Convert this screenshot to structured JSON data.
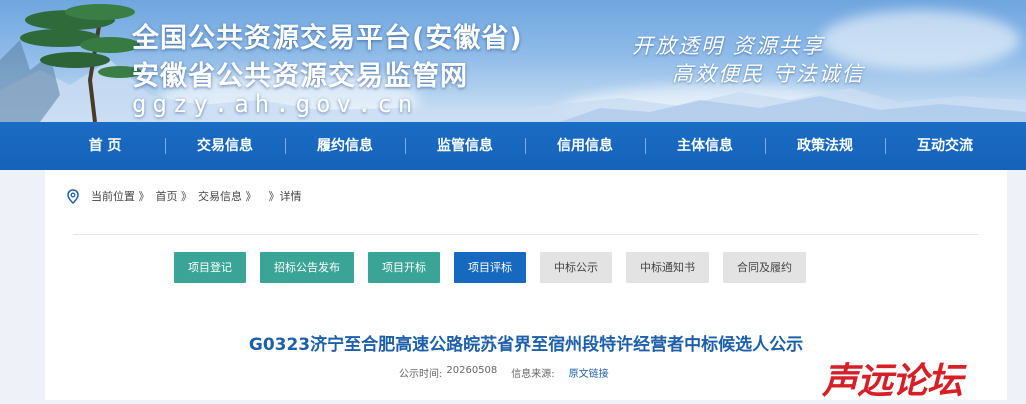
{
  "header": {
    "title_line1": "全国公共资源交易平台(安徽省)",
    "title_line2": "安徽省公共资源交易监管网",
    "domain": "ggzy.ah.gov.cn",
    "slogan_line1": "开放透明  资源共享",
    "slogan_line2": "高效便民  守法诚信"
  },
  "nav": {
    "items": [
      "首 页",
      "交易信息",
      "履约信息",
      "监管信息",
      "信用信息",
      "主体信息",
      "政策法规",
      "互动交流"
    ]
  },
  "breadcrumb": {
    "label": "当前位置 》",
    "home": "首页 》",
    "section": "交易信息 》",
    "current": "》详情"
  },
  "tabs": [
    {
      "label": "项目登记",
      "style": "green"
    },
    {
      "label": "招标公告发布",
      "style": "green"
    },
    {
      "label": "项目开标",
      "style": "green"
    },
    {
      "label": "项目评标",
      "style": "active"
    },
    {
      "label": "中标公示",
      "style": "gray"
    },
    {
      "label": "中标通知书",
      "style": "gray"
    },
    {
      "label": "合同及履约",
      "style": "gray"
    }
  ],
  "article": {
    "title": "G0323济宁至合肥高速公路皖苏省界至宿州段特许经营者中标候选人公示",
    "date_label": "公示时间:",
    "date": "20260508",
    "source_label": "信息来源:",
    "source_link": "原文链接"
  },
  "watermark": "声远论坛",
  "colors": {
    "nav_bg": "#1562b8",
    "tab_green": "#3aa596",
    "tab_active": "#1669bf",
    "tab_gray": "#e3e3e3",
    "title_blue": "#1e5faa",
    "watermark_red": "#d61f26"
  }
}
